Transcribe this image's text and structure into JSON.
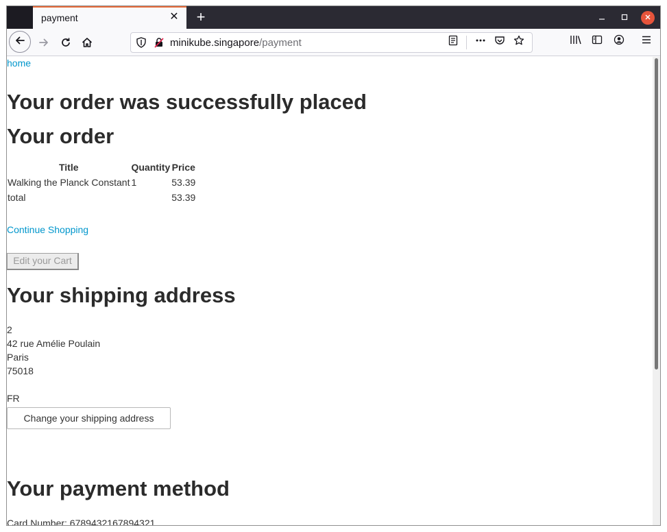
{
  "browser": {
    "tab_title": "payment",
    "tab_close": "✕",
    "new_tab": "+",
    "url_host": "minikube.singapore",
    "url_path": "/payment"
  },
  "page": {
    "home_link": "home",
    "success_heading": "Your order was successfully placed",
    "order_heading": "Your order",
    "table_headers": [
      "Title",
      "Quantity",
      "Price"
    ],
    "rows": [
      {
        "title": "Walking the Planck Constant",
        "quantity": "1",
        "price": "53.39"
      }
    ],
    "total_label": "total",
    "total_price": "53.39",
    "continue_link": "Continue Shopping",
    "edit_cart_button": "Edit your Cart",
    "shipping_heading": "Your shipping address",
    "address": {
      "line1": "2",
      "line2": "42 rue Amélie Poulain",
      "city": "Paris",
      "zip": "75018",
      "country": "FR"
    },
    "change_shipping_button": "Change your shipping address",
    "payment_heading": "Your payment method",
    "card_number": "Card Number: 6789432167894321"
  },
  "colors": {
    "link": "#0096cc",
    "text": "#333333",
    "tab_accent": "#e66a3a",
    "close_button": "#e6543b"
  }
}
